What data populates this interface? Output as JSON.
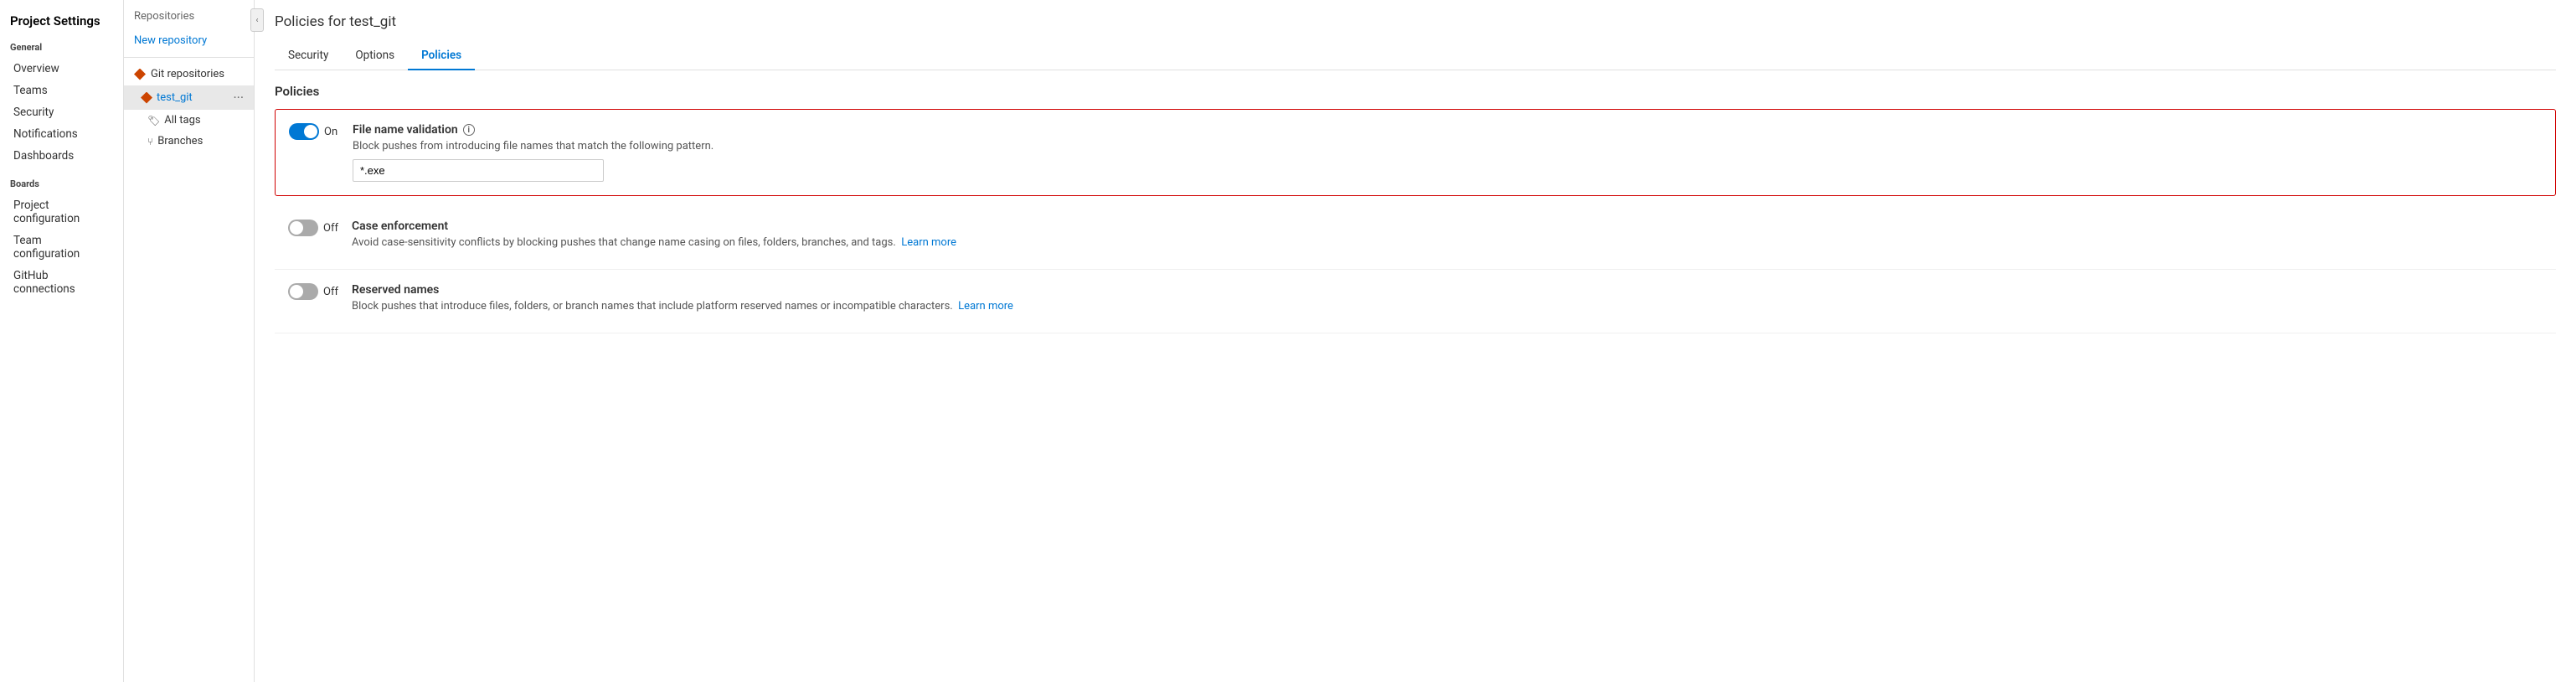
{
  "leftPanel": {
    "title": "Project Settings",
    "general": {
      "label": "General",
      "items": [
        {
          "id": "overview",
          "label": "Overview"
        },
        {
          "id": "teams",
          "label": "Teams"
        },
        {
          "id": "security",
          "label": "Security"
        },
        {
          "id": "notifications",
          "label": "Notifications"
        },
        {
          "id": "dashboards",
          "label": "Dashboards"
        }
      ]
    },
    "boards": {
      "label": "Boards",
      "items": [
        {
          "id": "project-configuration",
          "label": "Project configuration"
        },
        {
          "id": "team-configuration",
          "label": "Team configuration"
        },
        {
          "id": "github-connections",
          "label": "GitHub connections"
        }
      ]
    }
  },
  "middlePanel": {
    "title": "Repositories",
    "newRepo": "New repository",
    "gitSection": "Git repositories",
    "repo": {
      "name": "test_git",
      "subItems": [
        {
          "id": "all-tags",
          "label": "All tags",
          "icon": "tag"
        },
        {
          "id": "branches",
          "label": "Branches",
          "icon": "branch"
        }
      ]
    }
  },
  "mainContent": {
    "pageTitle": "Policies for test_git",
    "tabs": [
      {
        "id": "security",
        "label": "Security",
        "active": false
      },
      {
        "id": "options",
        "label": "Options",
        "active": false
      },
      {
        "id": "policies",
        "label": "Policies",
        "active": true
      }
    ],
    "sectionTitle": "Policies",
    "policies": [
      {
        "id": "file-name-validation",
        "name": "File name validation",
        "toggleOn": true,
        "toggleLabel": "On",
        "hasInput": true,
        "inputValue": "*.exe",
        "inputPlaceholder": "*.exe",
        "description": "Block pushes from introducing file names that match the following pattern.",
        "hasLearnMore": false,
        "highlighted": true
      },
      {
        "id": "case-enforcement",
        "name": "Case enforcement",
        "toggleOn": false,
        "toggleLabel": "Off",
        "hasInput": false,
        "description": "Avoid case-sensitivity conflicts by blocking pushes that change name casing on files, folders, branches, and tags.",
        "hasLearnMore": true,
        "learnMoreText": "Learn more",
        "highlighted": false
      },
      {
        "id": "reserved-names",
        "name": "Reserved names",
        "toggleOn": false,
        "toggleLabel": "Off",
        "hasInput": false,
        "description": "Block pushes that introduce files, folders, or branch names that include platform reserved names or incompatible characters.",
        "hasLearnMore": true,
        "learnMoreText": "Learn more",
        "highlighted": false
      }
    ]
  },
  "icons": {
    "collapseArrow": "‹",
    "info": "i",
    "moreOptions": "···"
  }
}
